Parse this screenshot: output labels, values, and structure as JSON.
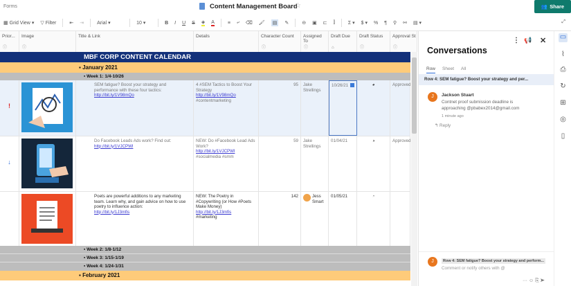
{
  "topbar": {
    "forms": "Forms",
    "title": "Content Management Board",
    "share": "Share"
  },
  "toolbar": {
    "view": "Grid View",
    "filter": "Filter",
    "font": "Arial",
    "size": "10"
  },
  "columns": [
    {
      "label": "Prior..."
    },
    {
      "label": "Image"
    },
    {
      "label": "Title & Link"
    },
    {
      "label": "Details"
    },
    {
      "label": "Character Count"
    },
    {
      "label": "Assigned To"
    },
    {
      "label": "Draft Due"
    },
    {
      "label": "Draft Status"
    },
    {
      "label": "Approval St"
    }
  ],
  "banner": "MBF CORP CONTENT CALENDAR",
  "months": [
    "January 2021",
    "February 2021"
  ],
  "weeks": [
    "Week 1: 1/4-10/26",
    "Week 2: 1/8-1/12",
    "Week 3: 1/15-1/19",
    "Week 4: 1/24-1/31"
  ],
  "rows": [
    {
      "priority": "!",
      "title": "SEM fatigue? Boost your strategy and performance with these four tactics:",
      "link": "http://bit.ly/1V98mQo",
      "details": "4 #SEM Tactics to Boost Your Strategy",
      "details_link": "http://bit.ly/1V98mQo",
      "tags": "#contentmarketing",
      "count": "95",
      "assigned": "Jake Strellings",
      "due": "10/26/21",
      "approval": "Approved"
    },
    {
      "priority": "↓",
      "title": "Do Facebook Leads Ads work? Find out:",
      "link": "http://bit.ly/1VJCPWl",
      "details": "NEW: Do #Facebook Lead Ads Work?",
      "details_link": "http://bit.ly/1VJCPWl",
      "tags": "#socialmedia #smm",
      "count": "59",
      "assigned": "Jake Strellings",
      "due": "01/04/21",
      "approval": "Approved"
    },
    {
      "priority": "",
      "title": "Poets are powerful additions to any marketing team. Learn why, and gain advice on how to use poetry to influence action:",
      "link": "http://bit.ly/1J3mfis",
      "details": "NEW: The Poetry in #Copywriting (or How #Poets Make Money)",
      "details_link": "http://bit.ly/1J3mfis",
      "tags": "#marketing",
      "count": "142",
      "assigned": "Jess Smart",
      "due": "01/05/21",
      "approval": ""
    }
  ],
  "panel": {
    "title": "Conversations",
    "tabs": [
      "Row",
      "Sheet",
      "All"
    ],
    "context": "Row 4: SEM fatigue? Boost your strategy and per...",
    "author": "Jackson Stuart",
    "message": "Contnet proof submission deadline is approaching @pbabex2014@gmail.com",
    "time": "1 minute ago",
    "reply": "Reply",
    "composer_context": "Row 4: SEM fatigue? Boost your strategy and perform...",
    "placeholder": "Comment or notify others with @",
    "avatar": "J"
  },
  "colors": {
    "accent": "#0f7a6c",
    "banner": "#13317a",
    "month": "#fecb7a",
    "week": "#bdbdbd"
  }
}
